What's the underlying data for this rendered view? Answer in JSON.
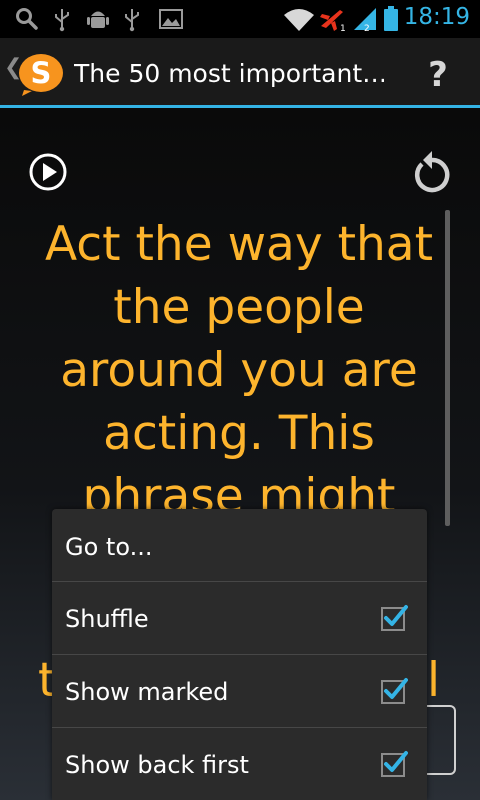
{
  "status_bar": {
    "time": "18:19",
    "icons": [
      "search-icon",
      "usb-icon",
      "android-debug-icon",
      "usb-icon",
      "image-icon",
      "wifi-icon",
      "airplane-icon",
      "signal-icon",
      "battery-icon"
    ],
    "accent": "#35b5e5"
  },
  "action_bar": {
    "title": "The 50 most important…",
    "help_label": "?",
    "up_caret": "❮",
    "logo_letter": "S",
    "logo_color": "#f7941e",
    "divider_color": "#34b4e6"
  },
  "card": {
    "text": "Act the way that the people around you are acting. This phrase might",
    "partial_left": "t",
    "partial_right": "l",
    "text_color": "#fdb42d"
  },
  "menu": {
    "items": [
      {
        "label": "Go to...",
        "checkable": false
      },
      {
        "label": "Shuffle",
        "checkable": true,
        "checked": true
      },
      {
        "label": "Show marked",
        "checkable": true,
        "checked": true
      },
      {
        "label": "Show back first",
        "checkable": true,
        "checked": true
      }
    ],
    "check_color": "#34b4e6"
  }
}
